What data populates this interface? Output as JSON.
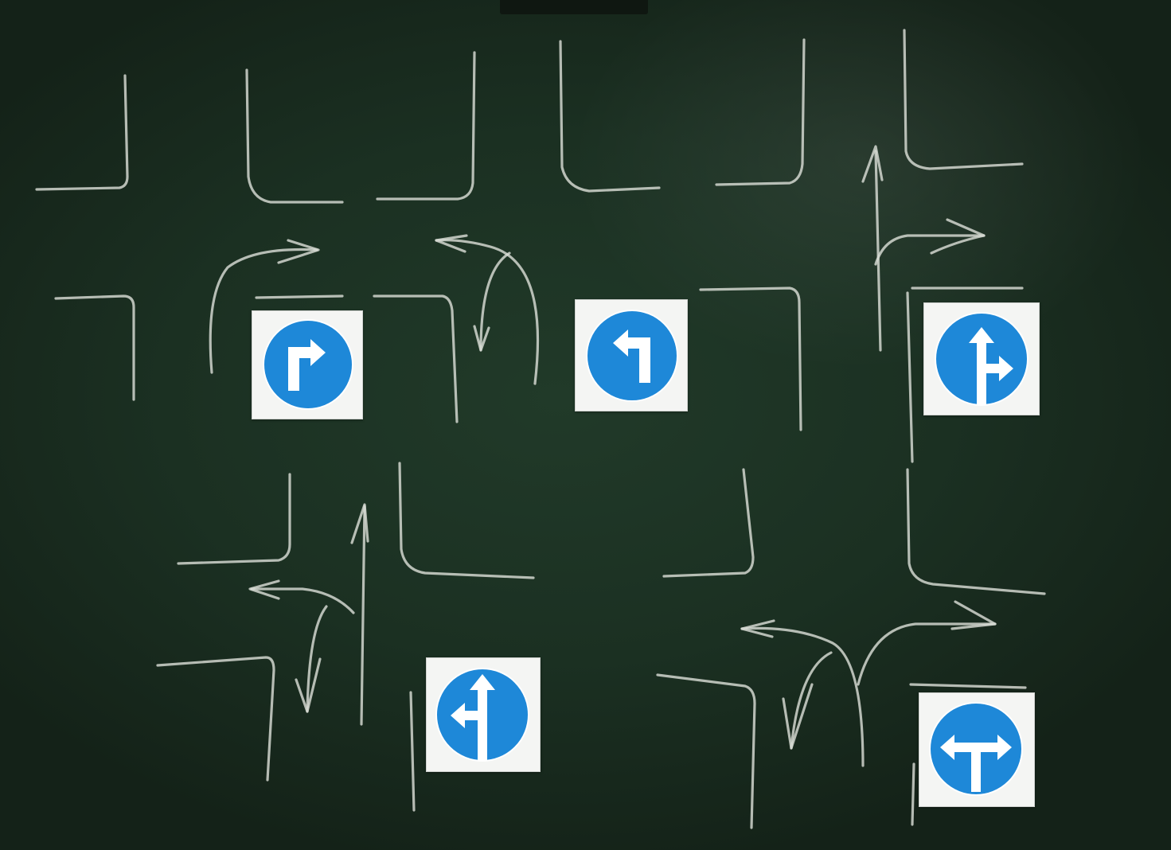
{
  "scene": {
    "surface": "chalkboard",
    "board_color": "#1b3022",
    "chalk_color": "#d9ddd5",
    "sign_color": "#1e88d8"
  },
  "signs": [
    {
      "icon": "turn-right-icon"
    },
    {
      "icon": "turn-left-icon"
    },
    {
      "icon": "straight-or-right-icon"
    },
    {
      "icon": "straight-or-left-icon"
    },
    {
      "icon": "left-or-right-icon"
    }
  ]
}
